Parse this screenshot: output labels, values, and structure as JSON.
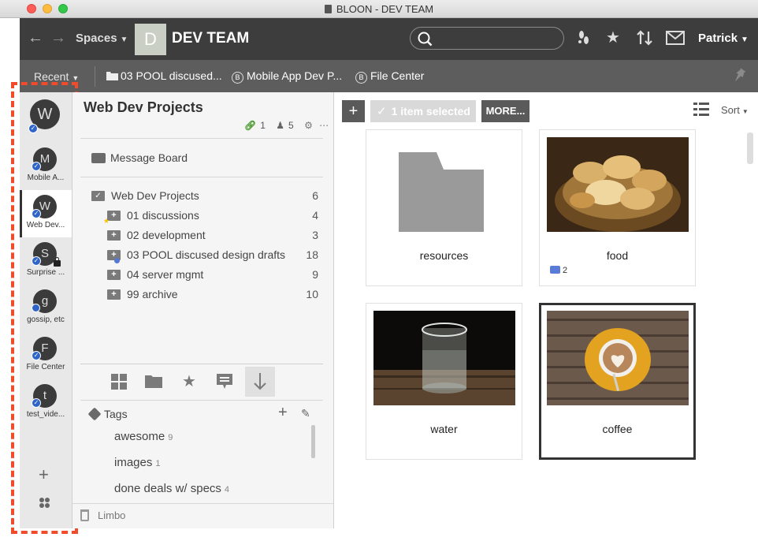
{
  "window": {
    "title": "BLOON - DEV TEAM"
  },
  "header": {
    "spaces_label": "Spaces",
    "space_initial": "D",
    "space_name": "DEV TEAM",
    "user_name": "Patrick",
    "search_placeholder": ""
  },
  "recentbar": {
    "recent_label": "Recent",
    "links": [
      {
        "label": "03 POOL discused...",
        "icon": "folder-icon"
      },
      {
        "label": "Mobile App Dev P...",
        "icon": "bloon-icon"
      },
      {
        "label": "File Center",
        "icon": "bloon-icon"
      }
    ]
  },
  "rail": {
    "top_avatar": "W",
    "items": [
      {
        "initial": "M",
        "label": "Mobile A..."
      },
      {
        "initial": "W",
        "label": "Web Dev..."
      },
      {
        "initial": "S",
        "label": "Surprise ..."
      },
      {
        "initial": "g",
        "label": "gossip, etc"
      },
      {
        "initial": "F",
        "label": "File Center"
      },
      {
        "initial": "t",
        "label": "test_vide..."
      }
    ]
  },
  "panel": {
    "title": "Web Dev Projects",
    "links_count": "1",
    "members_count": "5",
    "message_board": "Message Board",
    "tree": [
      {
        "label": "Web Dev Projects",
        "count": "6"
      },
      {
        "label": "01 discussions",
        "count": "4"
      },
      {
        "label": "02 development",
        "count": "3"
      },
      {
        "label": "03 POOL discused design drafts",
        "count": "18"
      },
      {
        "label": "04 server mgmt",
        "count": "9"
      },
      {
        "label": "99 archive",
        "count": "10"
      }
    ],
    "tags_label": "Tags",
    "tags": [
      {
        "label": "awesome",
        "count": "9"
      },
      {
        "label": "images",
        "count": "1"
      },
      {
        "label": "done deals w/ specs",
        "count": "4"
      }
    ],
    "limbo_label": "Limbo"
  },
  "main": {
    "selected_label": "1 item selected",
    "more_label": "MORE...",
    "sort_label": "Sort",
    "cards": [
      {
        "name": "resources",
        "comments": ""
      },
      {
        "name": "food",
        "comments": "2"
      },
      {
        "name": "water",
        "comments": ""
      },
      {
        "name": "coffee",
        "comments": ""
      }
    ]
  }
}
